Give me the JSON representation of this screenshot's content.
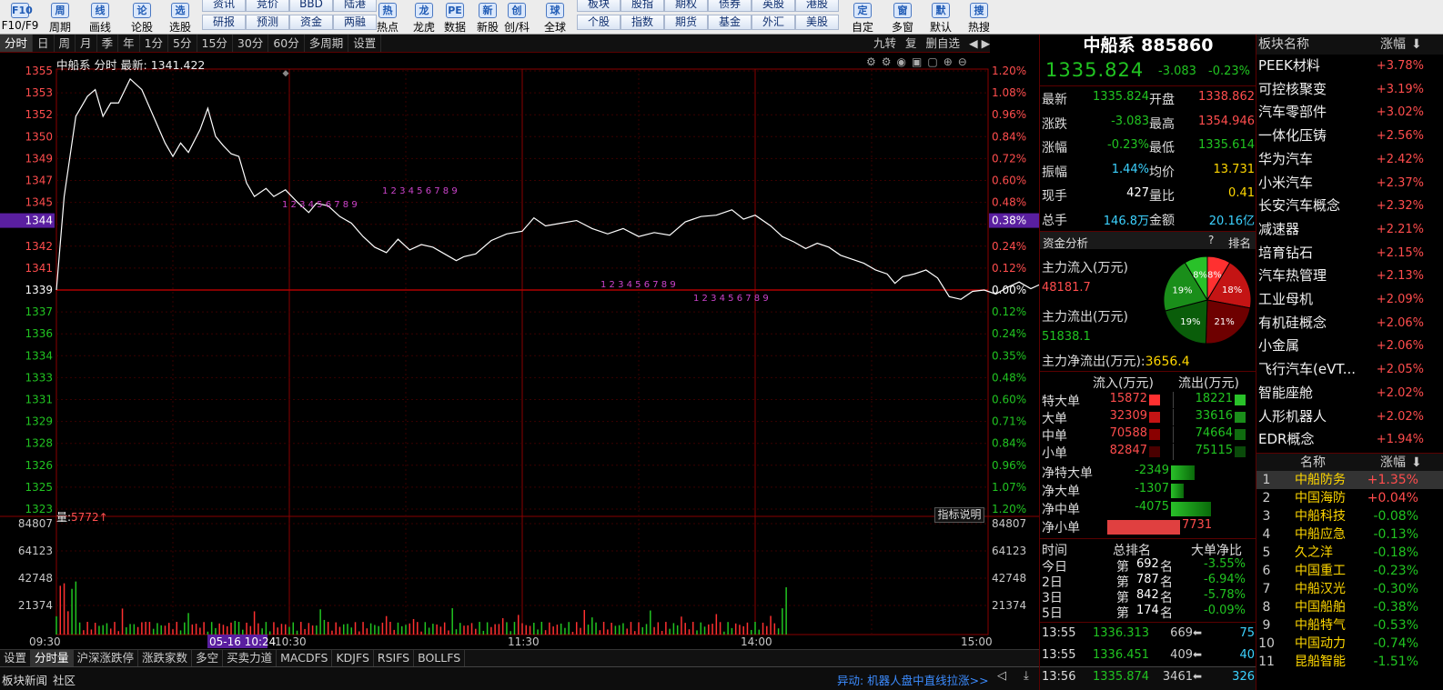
{
  "toolbar": {
    "big": [
      {
        "label": "F10/F9",
        "icon": "F10"
      },
      {
        "label": "周期",
        "icon": "周"
      },
      {
        "label": "画线",
        "icon": "线"
      },
      {
        "label": "论股",
        "icon": "论"
      },
      {
        "label": "选股",
        "icon": "选"
      },
      {
        "label": "热点",
        "icon": "热"
      },
      {
        "label": "龙虎",
        "icon": "龙"
      },
      {
        "label": "数据",
        "icon": "PE"
      },
      {
        "label": "新股",
        "icon": "新"
      },
      {
        "label": "创/科",
        "icon": "创"
      },
      {
        "label": "全球",
        "icon": "球"
      },
      {
        "label": "自定",
        "icon": "定"
      },
      {
        "label": "多窗",
        "icon": "窗"
      },
      {
        "label": "默认",
        "icon": "默"
      },
      {
        "label": "热搜",
        "icon": "搜"
      }
    ],
    "small_top": [
      "资讯",
      "竞价",
      "BBD",
      "陆港",
      "板块",
      "股指",
      "期权",
      "债券",
      "英股",
      "港股"
    ],
    "small_bottom": [
      "研报",
      "预测",
      "资金",
      "两融",
      "个股",
      "指数",
      "期货",
      "基金",
      "外汇",
      "美股"
    ]
  },
  "tabs": [
    "分时",
    "日",
    "周",
    "月",
    "季",
    "年",
    "1分",
    "5分",
    "15分",
    "30分",
    "60分",
    "多周期",
    "设置"
  ],
  "tabs_right": [
    "九转",
    "复",
    "删自选"
  ],
  "chart_header": {
    "name": "中船系",
    "mode": "分时",
    "latest_label": "最新:",
    "latest_value": "1341.422"
  },
  "chart_data": {
    "type": "line",
    "title": "中船系 分时",
    "prev_close": 1339,
    "current_marker": "1344",
    "y_ticks_left": [
      "1355",
      "1353",
      "1352",
      "1350",
      "1349",
      "1347",
      "1345",
      "1344",
      "1342",
      "1341",
      "1339",
      "1337",
      "1336",
      "1334",
      "1333",
      "1331",
      "1329",
      "1328",
      "1326",
      "1325",
      "1323"
    ],
    "y_ticks_right": [
      "1.20%",
      "1.08%",
      "0.96%",
      "0.84%",
      "0.72%",
      "0.60%",
      "0.48%",
      "0.38%",
      "0.24%",
      "0.12%",
      "0.00%",
      "0.12%",
      "0.24%",
      "0.35%",
      "0.48%",
      "0.60%",
      "0.71%",
      "0.84%",
      "0.96%",
      "1.07%",
      "1.20%"
    ],
    "x_ticks": [
      "09:30",
      "10:30",
      "11:30",
      "14:00",
      "15:00"
    ],
    "highlight_time": "05-16 10:24",
    "price": [
      [
        0,
        1339
      ],
      [
        2,
        1346
      ],
      [
        5,
        1352
      ],
      [
        8,
        1353.5
      ],
      [
        10,
        1354
      ],
      [
        12,
        1352
      ],
      [
        14,
        1353
      ],
      [
        16,
        1353
      ],
      [
        19,
        1354.8
      ],
      [
        22,
        1354
      ],
      [
        25,
        1352
      ],
      [
        28,
        1350
      ],
      [
        30,
        1349
      ],
      [
        32,
        1350
      ],
      [
        34,
        1349.3
      ],
      [
        37,
        1351
      ],
      [
        39,
        1352.6
      ],
      [
        41,
        1350.5
      ],
      [
        43,
        1349.8
      ],
      [
        45,
        1349.2
      ],
      [
        47,
        1349
      ],
      [
        49,
        1347
      ],
      [
        51,
        1346
      ],
      [
        54,
        1346.6
      ],
      [
        56,
        1346
      ],
      [
        59,
        1346.5
      ],
      [
        62,
        1345.6
      ],
      [
        65,
        1344.8
      ],
      [
        67,
        1345.5
      ],
      [
        70,
        1345.3
      ],
      [
        73,
        1344.5
      ],
      [
        76,
        1344
      ],
      [
        79,
        1343
      ],
      [
        82,
        1342.2
      ],
      [
        85,
        1341.8
      ],
      [
        88,
        1342.8
      ],
      [
        91,
        1342
      ],
      [
        94,
        1342.4
      ],
      [
        97,
        1342.2
      ],
      [
        100,
        1341.7
      ],
      [
        103,
        1341.2
      ],
      [
        105,
        1341.5
      ],
      [
        108,
        1341.7
      ],
      [
        112,
        1342.7
      ],
      [
        116,
        1343.2
      ],
      [
        120,
        1343.4
      ],
      [
        123,
        1344.4
      ],
      [
        126,
        1343.8
      ],
      [
        130,
        1344
      ],
      [
        134,
        1344.2
      ],
      [
        138,
        1343.6
      ],
      [
        142,
        1343.2
      ],
      [
        146,
        1343.6
      ],
      [
        150,
        1343
      ],
      [
        154,
        1343.3
      ],
      [
        158,
        1343.1
      ],
      [
        162,
        1344.1
      ],
      [
        166,
        1344.5
      ],
      [
        170,
        1344.6
      ],
      [
        174,
        1345
      ],
      [
        177,
        1344.3
      ],
      [
        180,
        1344.6
      ],
      [
        184,
        1343.8
      ],
      [
        187,
        1343
      ],
      [
        190,
        1342.6
      ],
      [
        193,
        1342.1
      ],
      [
        196,
        1342.5
      ],
      [
        199,
        1342.2
      ],
      [
        202,
        1341.6
      ],
      [
        205,
        1341.3
      ],
      [
        208,
        1341
      ],
      [
        211,
        1340.5
      ],
      [
        214,
        1340.2
      ],
      [
        216,
        1339.5
      ],
      [
        218,
        1340
      ],
      [
        221,
        1340.2
      ],
      [
        224,
        1340.5
      ],
      [
        227,
        1339.9
      ],
      [
        230,
        1338.5
      ],
      [
        233,
        1338.3
      ],
      [
        236,
        1338.9
      ],
      [
        239,
        1339
      ],
      [
        242,
        1338.7
      ],
      [
        245,
        1339.2
      ],
      [
        248,
        1339.6
      ],
      [
        251,
        1339.1
      ],
      [
        254,
        1339.5
      ],
      [
        257,
        1338.7
      ],
      [
        260,
        1339.6
      ],
      [
        263,
        1340.3
      ],
      [
        266,
        1339.7
      ],
      [
        269,
        1339.2
      ],
      [
        272,
        1338.6
      ],
      [
        275,
        1339
      ],
      [
        278,
        1338.4
      ],
      [
        281,
        1338.2
      ],
      [
        284,
        1338.5
      ],
      [
        287,
        1338.4
      ],
      [
        290,
        1337.6
      ],
      [
        293,
        1338.5
      ],
      [
        296,
        1338.2
      ],
      [
        299,
        1338.6
      ],
      [
        302,
        1338.3
      ],
      [
        305,
        1339.1
      ],
      [
        308,
        1339.6
      ],
      [
        311,
        1339
      ],
      [
        314,
        1338.8
      ],
      [
        317,
        1338.1
      ],
      [
        320,
        1337.4
      ],
      [
        323,
        1336.8
      ],
      [
        326,
        1336.6
      ],
      [
        329,
        1336.2
      ],
      [
        332,
        1336.5
      ],
      [
        335,
        1336
      ]
    ],
    "volume_ticks": [
      "84807",
      "64123",
      "42748",
      "21374"
    ],
    "volume_label": "量:",
    "volume_value": "5772↑"
  },
  "annotations": {
    "a": "1 2 3 4 5 6 7 8 9",
    "b": "1 2 3 4 5 6 7 8 9",
    "c": "1 2 3 4 5 6 7 8 9",
    "d": "1 2 3 4 5 6 7 8 9"
  },
  "indicator_btn": "指标说明",
  "quote": {
    "title": "中船系 885860",
    "price": "1335.824",
    "change": "-3.083",
    "pct": "-0.23%",
    "rows": [
      {
        "l1": "最新",
        "v1": "1335.824",
        "l2": "开盘",
        "v2": "1338.862"
      },
      {
        "l1": "涨跌",
        "v1": "-3.083",
        "l2": "最高",
        "v2": "1354.946"
      },
      {
        "l1": "涨幅",
        "v1": "-0.23%",
        "l2": "最低",
        "v2": "1335.614"
      },
      {
        "l1": "振幅",
        "v1": "1.44%",
        "l2": "均价",
        "v2": "13.731"
      },
      {
        "l1": "现手",
        "v1": "427",
        "l2": "量比",
        "v2": "0.41"
      },
      {
        "l1": "总手",
        "v1": "146.8万",
        "l2": "金额",
        "v2": "20.16亿"
      }
    ]
  },
  "fund": {
    "title": "资金分析",
    "help": "?",
    "rank": "排名",
    "in_label": "主力流入(万元)",
    "in_value": "48181.7",
    "out_label": "主力流出(万元)",
    "out_value": "51838.1",
    "net_label": "主力净流出(万元):",
    "net_value": "3656.4",
    "pie": [
      {
        "label": "8%",
        "value": 8,
        "color": "#ff3030"
      },
      {
        "label": "18%",
        "value": 18,
        "color": "#c41414"
      },
      {
        "label": "21%",
        "value": 21,
        "color": "#6e0000"
      },
      {
        "label": "19%",
        "value": 19,
        "color": "#0a5d0a"
      },
      {
        "label": "19%",
        "value": 19,
        "color": "#1a8e1a"
      },
      {
        "label": "8%",
        "value": 8,
        "color": "#29c129"
      }
    ],
    "flow_header": [
      "流入(万元)",
      "流出(万元)"
    ],
    "flow": [
      {
        "name": "特大单",
        "in": "15872",
        "out": "18221",
        "inlv": 0.19,
        "outlv": 0.24
      },
      {
        "name": "大单",
        "in": "32309",
        "out": "33616",
        "inlv": 0.39,
        "outlv": 0.45
      },
      {
        "name": "中单",
        "in": "70588",
        "out": "74664",
        "inlv": 0.85,
        "outlv": 1.0
      },
      {
        "name": "小单",
        "in": "82847",
        "out": "75115",
        "inlv": 1.0,
        "outlv": 1.0
      }
    ],
    "net": [
      {
        "name": "净特大单",
        "value": "-2349",
        "lv": 0.32
      },
      {
        "name": "净大单",
        "value": "-1307",
        "lv": 0.18
      },
      {
        "name": "净中单",
        "value": "-4075",
        "lv": 0.55
      },
      {
        "name": "净小单",
        "value": "7731",
        "lv": 1.0
      }
    ],
    "rank_header": [
      "时间",
      "总排名",
      "大单净比"
    ],
    "ranks": [
      {
        "t": "今日",
        "p": "第",
        "n": "692",
        "s": "名",
        "r": "-3.55%"
      },
      {
        "t": "2日",
        "p": "第",
        "n": "787",
        "s": "名",
        "r": "-6.94%"
      },
      {
        "t": "3日",
        "p": "第",
        "n": "842",
        "s": "名",
        "r": "-5.78%"
      },
      {
        "t": "5日",
        "p": "第",
        "n": "174",
        "s": "名",
        "r": "-0.09%"
      }
    ],
    "ticks": [
      {
        "t": "13:55",
        "p": "1336.313",
        "v": "669",
        "c": "75"
      },
      {
        "t": "13:55",
        "p": "1336.451",
        "v": "409",
        "c": "40"
      },
      {
        "t": "13:56",
        "p": "1335.874",
        "v": "3461",
        "c": "326"
      }
    ]
  },
  "sectors": {
    "h1": "板块名称",
    "h2": "涨幅",
    "items": [
      {
        "n": "PEEK材料",
        "v": "+3.78%"
      },
      {
        "n": "可控核聚变",
        "v": "+3.19%"
      },
      {
        "n": "汽车零部件",
        "v": "+3.02%"
      },
      {
        "n": "一体化压铸",
        "v": "+2.56%"
      },
      {
        "n": "华为汽车",
        "v": "+2.42%"
      },
      {
        "n": "小米汽车",
        "v": "+2.37%"
      },
      {
        "n": "长安汽车概念",
        "v": "+2.32%"
      },
      {
        "n": "减速器",
        "v": "+2.21%"
      },
      {
        "n": "培育钻石",
        "v": "+2.15%"
      },
      {
        "n": "汽车热管理",
        "v": "+2.13%"
      },
      {
        "n": "工业母机",
        "v": "+2.09%"
      },
      {
        "n": "有机硅概念",
        "v": "+2.06%"
      },
      {
        "n": "小金属",
        "v": "+2.06%"
      },
      {
        "n": "飞行汽车(eVT...",
        "v": "+2.05%"
      },
      {
        "n": "智能座舱",
        "v": "+2.02%"
      },
      {
        "n": "人形机器人",
        "v": "+2.02%"
      },
      {
        "n": "EDR概念",
        "v": "+1.94%"
      }
    ]
  },
  "constituents": {
    "h1": "名称",
    "h2": "涨幅",
    "items": [
      {
        "i": "1",
        "n": "中船防务",
        "v": "+1.35%",
        "up": true
      },
      {
        "i": "2",
        "n": "中国海防",
        "v": "+0.04%",
        "up": true
      },
      {
        "i": "3",
        "n": "中船科技",
        "v": "-0.08%",
        "up": false
      },
      {
        "i": "4",
        "n": "中船应急",
        "v": "-0.13%",
        "up": false
      },
      {
        "i": "5",
        "n": "久之洋",
        "v": "-0.18%",
        "up": false
      },
      {
        "i": "6",
        "n": "中国重工",
        "v": "-0.23%",
        "up": false
      },
      {
        "i": "7",
        "n": "中船汉光",
        "v": "-0.30%",
        "up": false
      },
      {
        "i": "8",
        "n": "中国船舶",
        "v": "-0.38%",
        "up": false
      },
      {
        "i": "9",
        "n": "中船特气",
        "v": "-0.53%",
        "up": false
      },
      {
        "i": "10",
        "n": "中国动力",
        "v": "-0.74%",
        "up": false
      },
      {
        "i": "11",
        "n": "昆船智能",
        "v": "-1.51%",
        "up": false
      }
    ]
  },
  "bottom_tabs": [
    "设置",
    "分时量",
    "沪深涨跌停",
    "涨跌家数",
    "多空",
    "买卖力道",
    "MACDFS",
    "KDJFS",
    "RSIFS",
    "BOLLFS"
  ],
  "status": {
    "left1": "板块新闻",
    "left2": "社区",
    "ticker": "异动: 机器人盘中直线拉涨>>"
  }
}
